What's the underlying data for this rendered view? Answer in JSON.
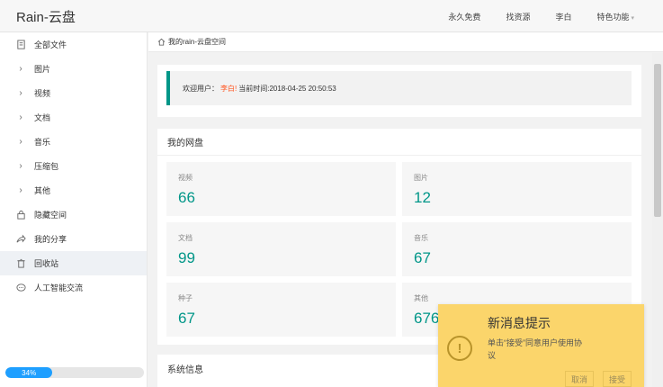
{
  "header": {
    "logo": "Rain-云盘",
    "nav": [
      "永久免费",
      "找资源",
      "李白",
      "特色功能"
    ]
  },
  "sidebar": {
    "items": [
      {
        "icon": "file-icon",
        "label": "全部文件"
      },
      {
        "icon": "chevron-right-icon",
        "label": "图片"
      },
      {
        "icon": "chevron-right-icon",
        "label": "视频"
      },
      {
        "icon": "chevron-right-icon",
        "label": "文档"
      },
      {
        "icon": "chevron-right-icon",
        "label": "音乐"
      },
      {
        "icon": "chevron-right-icon",
        "label": "压缩包"
      },
      {
        "icon": "chevron-right-icon",
        "label": "其他"
      },
      {
        "icon": "lock-icon",
        "label": "隐藏空间"
      },
      {
        "icon": "share-icon",
        "label": "我的分享"
      },
      {
        "icon": "trash-icon",
        "label": "回收站"
      },
      {
        "icon": "chat-icon",
        "label": "人工智能交流"
      }
    ],
    "storage_progress": "34%"
  },
  "breadcrumb": {
    "text": "我的rain-云盘空间"
  },
  "welcome": {
    "prefix": "欢迎用户：",
    "username": "李白!",
    "time_label": "当前时间:2018-04-25 20:50:53"
  },
  "disk": {
    "title": "我的网盘",
    "stats": [
      {
        "label": "视频",
        "value": "66"
      },
      {
        "label": "图片",
        "value": "12"
      },
      {
        "label": "文档",
        "value": "99"
      },
      {
        "label": "音乐",
        "value": "67"
      },
      {
        "label": "种子",
        "value": "67"
      },
      {
        "label": "其他",
        "value": "676"
      }
    ]
  },
  "system": {
    "title": "系统信息"
  },
  "popup": {
    "title": "新消息提示",
    "message": "单击“接受”同意用户使用协议",
    "cancel": "取消",
    "accept": "接受"
  },
  "colors": {
    "accent": "#009688",
    "username": "#ff5722",
    "progress": "#1e9fff",
    "popup_bg": "#fbd56b"
  }
}
